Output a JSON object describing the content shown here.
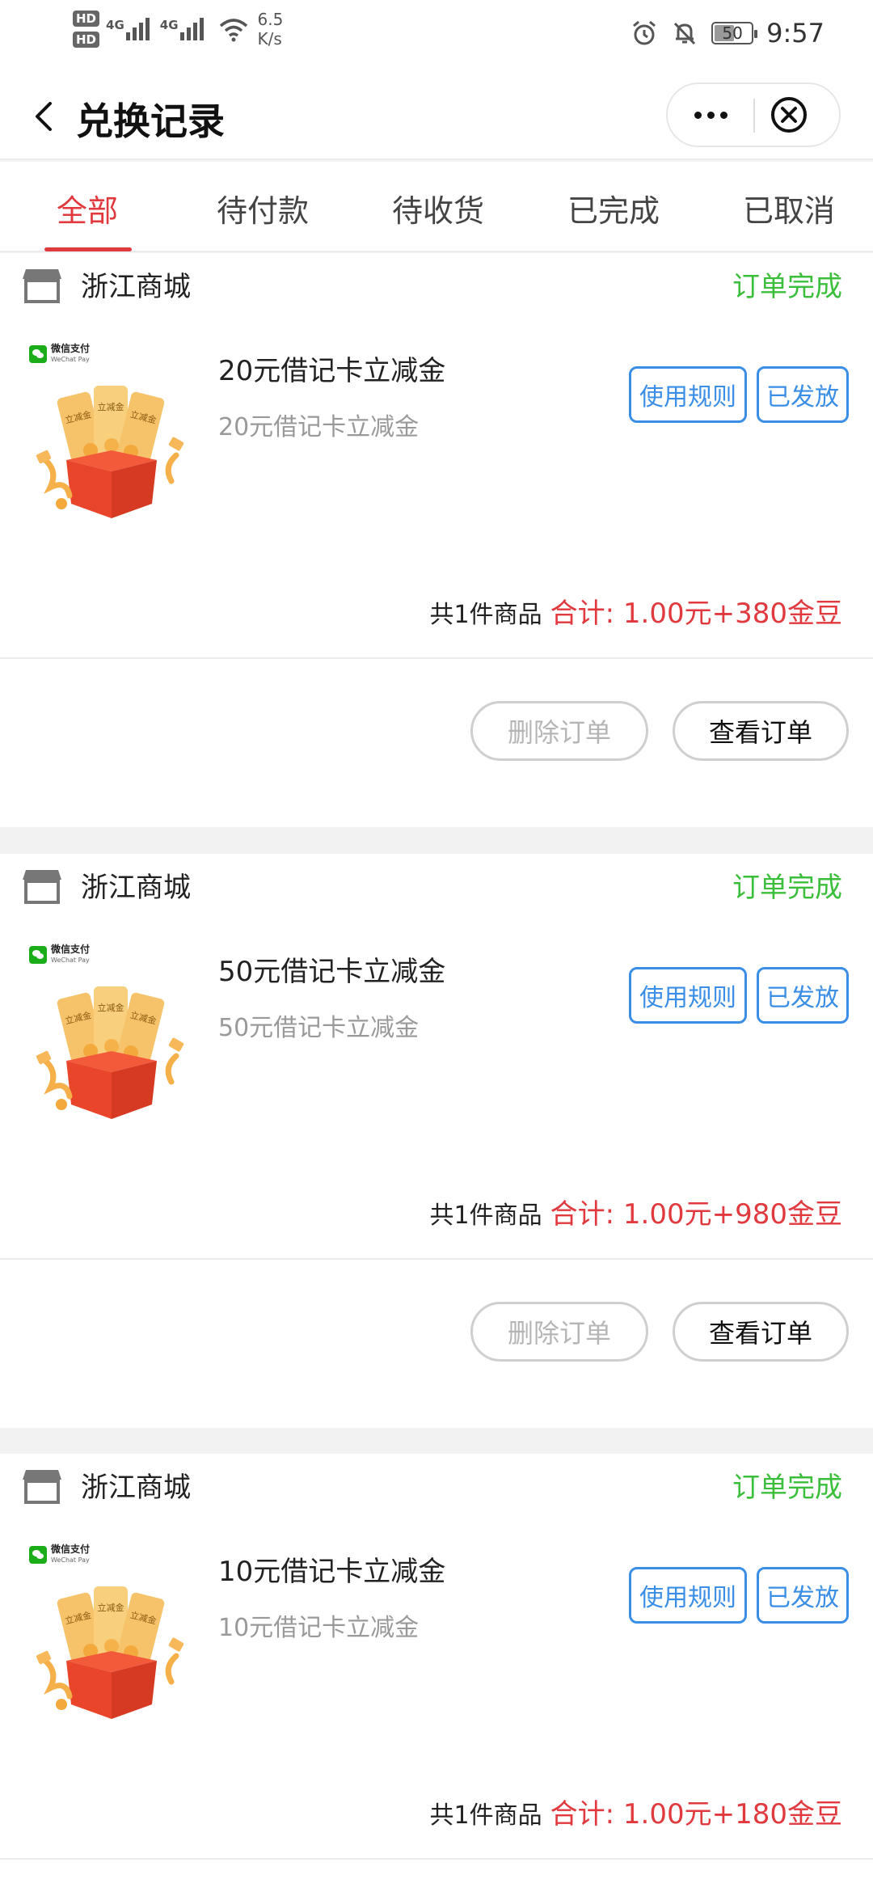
{
  "status_bar": {
    "hd1": "HD",
    "hd2": "HD",
    "net1": "4G",
    "net2": "4G",
    "speed_value": "6.5",
    "speed_unit": "K/s",
    "battery": "50",
    "time": "9:57",
    "icons": [
      "alarm-icon",
      "bell-off-icon",
      "battery-icon",
      "wifi-icon"
    ]
  },
  "header": {
    "title": "兑换记录",
    "icons": [
      "back-icon",
      "more-icon",
      "close-icon"
    ]
  },
  "tabs": [
    {
      "label": "全部",
      "active": true
    },
    {
      "label": "待付款",
      "active": false
    },
    {
      "label": "待收货",
      "active": false
    },
    {
      "label": "已完成",
      "active": false
    },
    {
      "label": "已取消",
      "active": false
    }
  ],
  "thumbnail": {
    "brand_cn": "微信支付",
    "brand_en": "WeChat Pay",
    "ticket_text": "立减金"
  },
  "orders": [
    {
      "store": "浙江商城",
      "status": "订单完成",
      "item_title": "20元借记卡立减金",
      "item_subtitle": "20元借记卡立减金",
      "rule_label": "使用规则",
      "issued_label": "已发放",
      "count_text": "共1件商品",
      "total_text": "合计: 1.00元+380金豆",
      "delete_label": "删除订单",
      "view_label": "查看订单"
    },
    {
      "store": "浙江商城",
      "status": "订单完成",
      "item_title": "50元借记卡立减金",
      "item_subtitle": "50元借记卡立减金",
      "rule_label": "使用规则",
      "issued_label": "已发放",
      "count_text": "共1件商品",
      "total_text": "合计: 1.00元+980金豆",
      "delete_label": "删除订单",
      "view_label": "查看订单"
    },
    {
      "store": "浙江商城",
      "status": "订单完成",
      "item_title": "10元借记卡立减金",
      "item_subtitle": "10元借记卡立减金",
      "rule_label": "使用规则",
      "issued_label": "已发放",
      "count_text": "共1件商品",
      "total_text": "合计: 1.00元+180金豆"
    }
  ],
  "colors": {
    "accent_red": "#e0393e",
    "status_green": "#3bbf3b",
    "button_blue": "#3a8ee6"
  }
}
